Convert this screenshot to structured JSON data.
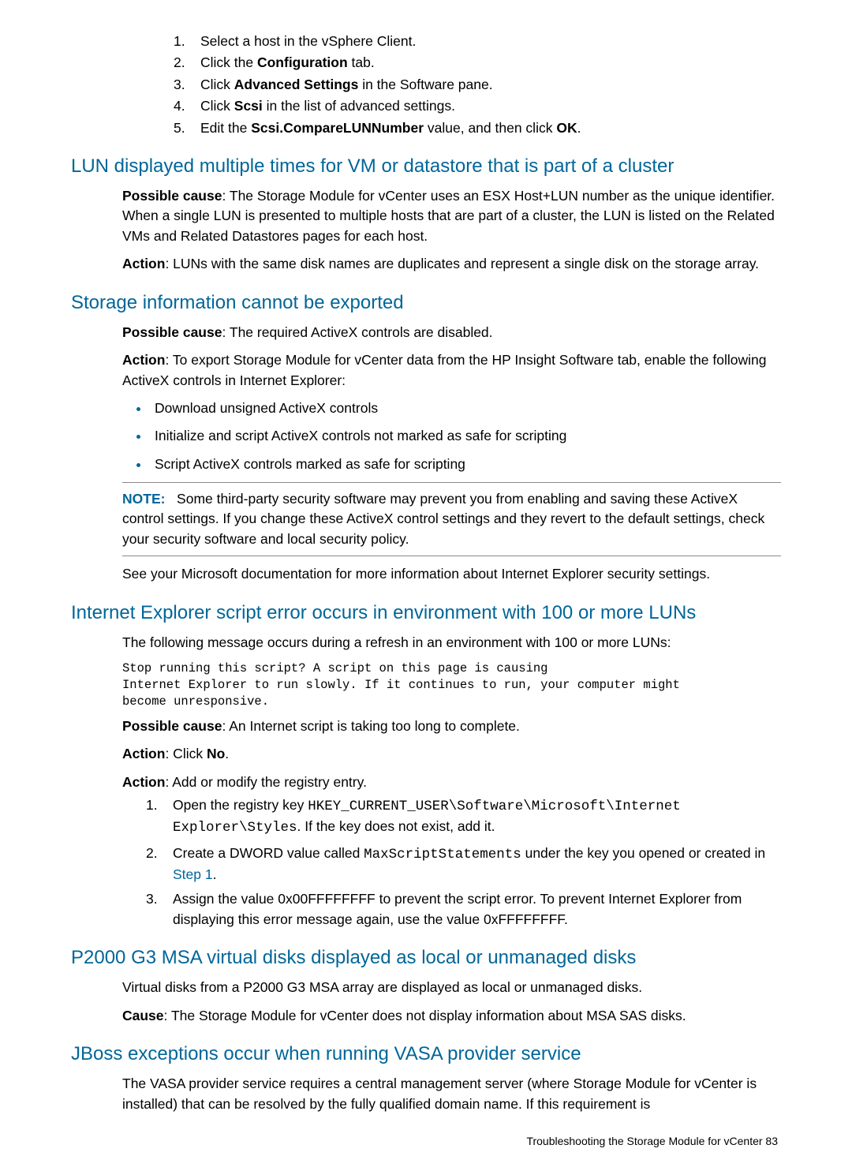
{
  "top_steps": {
    "s1_a": "Select a host in the vSphere Client.",
    "s2_a": "Click the ",
    "s2_b": "Configuration",
    "s2_c": " tab.",
    "s3_a": "Click ",
    "s3_b": "Advanced Settings",
    "s3_c": " in the Software pane.",
    "s4_a": "Click ",
    "s4_b": "Scsi",
    "s4_c": " in the list of advanced settings.",
    "s5_a": "Edit the ",
    "s5_b": "Scsi.CompareLUNNumber",
    "s5_c": " value, and then click ",
    "s5_d": "OK",
    "s5_e": "."
  },
  "sec_lun": {
    "heading": "LUN displayed multiple times for VM or datastore that is part of a cluster",
    "cause_lbl": "Possible cause",
    "cause_txt": ": The Storage Module for vCenter uses an ESX Host+LUN number as the unique identifier. When a single LUN is presented to multiple hosts that are part of a cluster, the LUN is listed on the Related VMs and Related Datastores pages for each host.",
    "action_lbl": "Action",
    "action_txt": ": LUNs with the same disk names are duplicates and represent a single disk on the storage array."
  },
  "sec_export": {
    "heading": "Storage information cannot be exported",
    "cause_lbl": "Possible cause",
    "cause_txt": ": The required ActiveX controls are disabled.",
    "action_lbl": "Action",
    "action_txt": ": To export Storage Module for vCenter data from the HP Insight Software tab, enable the following ActiveX controls in Internet Explorer:",
    "b1": "Download unsigned ActiveX controls",
    "b2": "Initialize and script ActiveX controls not marked as safe for scripting",
    "b3": "Script ActiveX controls marked as safe for scripting",
    "note_lbl": "NOTE:",
    "note_txt": "Some third-party security software may prevent you from enabling and saving these ActiveX control settings. If you change these ActiveX control settings and they revert to the default settings, check your security software and local security policy.",
    "after_note": "See your Microsoft documentation for more information about Internet Explorer security settings."
  },
  "sec_ie": {
    "heading": "Internet Explorer script error occurs in environment with 100 or more LUNs",
    "intro": "The following message occurs during a refresh in an environment with 100 or more LUNs:",
    "code": "Stop running this script? A script on this page is causing\nInternet Explorer to run slowly. If it continues to run, your computer might\nbecome unresponsive.",
    "cause_lbl": "Possible cause",
    "cause_txt": ": An Internet script is taking too long to complete.",
    "action1_lbl": "Action",
    "action1_a": ": Click ",
    "action1_b": "No",
    "action1_c": ".",
    "action2_lbl": "Action",
    "action2_txt": ": Add or modify the registry entry.",
    "s1_a": "Open the registry key ",
    "s1_b": "HKEY_CURRENT_USER\\Software\\Microsoft\\Internet Explorer\\Styles",
    "s1_c": ". If the key does not exist, add it.",
    "s2_a": "Create a DWORD value called ",
    "s2_b": "MaxScriptStatements",
    "s2_c": " under the key you opened or created in ",
    "s2_d": "Step 1",
    "s2_e": ".",
    "s3": "Assign the value 0x00FFFFFFFF to prevent the script error. To prevent Internet Explorer from displaying this error message again, use the value 0xFFFFFFFF."
  },
  "sec_p2000": {
    "heading": "P2000 G3 MSA virtual disks displayed as local or unmanaged disks",
    "p1": "Virtual disks from a P2000 G3 MSA array are displayed as local or unmanaged disks.",
    "cause_lbl": "Cause",
    "cause_txt": ": The Storage Module for vCenter does not display information about MSA SAS disks."
  },
  "sec_jboss": {
    "heading": "JBoss exceptions occur when running VASA provider service",
    "p1": "The VASA provider service requires a central management server (where Storage Module for vCenter is installed) that can be resolved by the fully qualified domain name. If this requirement is"
  },
  "footer": "Troubleshooting the Storage Module for vCenter     83"
}
